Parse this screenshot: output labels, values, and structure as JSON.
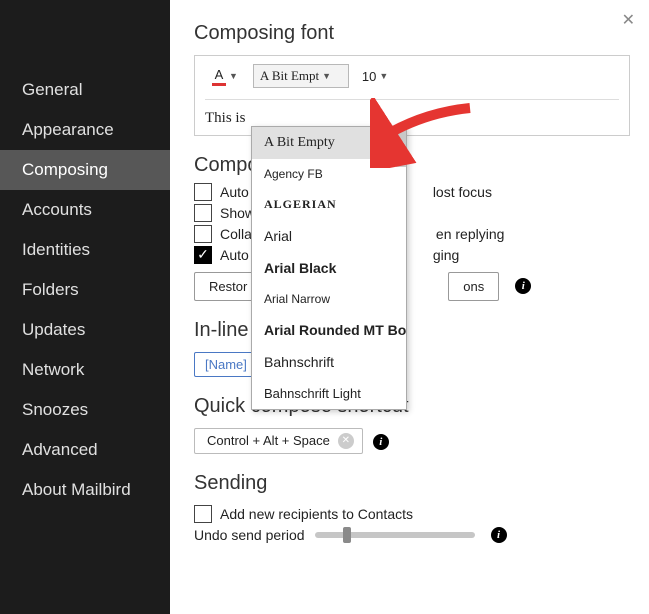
{
  "sidebar": {
    "items": [
      {
        "label": "General"
      },
      {
        "label": "Appearance"
      },
      {
        "label": "Composing",
        "active": true
      },
      {
        "label": "Accounts"
      },
      {
        "label": "Identities"
      },
      {
        "label": "Folders"
      },
      {
        "label": "Updates"
      },
      {
        "label": "Network"
      },
      {
        "label": "Snoozes"
      },
      {
        "label": "Advanced"
      },
      {
        "label": "About Mailbird"
      }
    ]
  },
  "close_symbol": "✕",
  "font_section": {
    "title": "Composing font",
    "color_letter": "A",
    "selected_font": "A Bit Empt",
    "selected_size": "10",
    "preview_text": "This is"
  },
  "font_dropdown": {
    "items": [
      {
        "label": "A Bit Empty",
        "family": "'Comic Sans MS', cursive",
        "weight": "400",
        "selected": true
      },
      {
        "label": "Agency FB",
        "family": "'Arial Narrow', Arial, sans-serif",
        "weight": "400",
        "size": "12px"
      },
      {
        "label": "ALGERIAN",
        "family": "'Times New Roman', serif",
        "weight": "700",
        "spacing": "1px",
        "size": "12px"
      },
      {
        "label": "Arial",
        "family": "Arial, sans-serif",
        "weight": "400"
      },
      {
        "label": "Arial Black",
        "family": "'Arial Black', Arial, sans-serif",
        "weight": "900"
      },
      {
        "label": "Arial Narrow",
        "family": "'Arial Narrow', Arial, sans-serif",
        "weight": "400",
        "size": "12px"
      },
      {
        "label": "Arial Rounded MT Bold",
        "family": "Arial, sans-serif",
        "weight": "700"
      },
      {
        "label": "Bahnschrift",
        "family": "Bahnschrift, Arial, sans-serif",
        "weight": "400"
      },
      {
        "label": "Bahnschrift Light",
        "family": "Bahnschrift, Arial, sans-serif",
        "weight": "300",
        "size": "13px"
      }
    ]
  },
  "composing": {
    "title": "Compo",
    "rows": [
      {
        "checked": false,
        "pre": "Auto",
        "post": "lost focus"
      },
      {
        "checked": false,
        "pre": "Show",
        "post": ""
      },
      {
        "checked": false,
        "pre": "Colla",
        "post": "en replying"
      },
      {
        "checked": true,
        "pre": "Auto",
        "post": "ging"
      }
    ],
    "btn_left": "Restor",
    "btn_right": "ons"
  },
  "inline": {
    "title": "In-line",
    "tag": "[Name]"
  },
  "shortcut": {
    "title": "Quick compose shortcut",
    "value": "Control + Alt + Space",
    "clear": "✕"
  },
  "sending": {
    "title": "Sending",
    "row_label": "Add new recipients to Contacts",
    "undo_label": "Undo send period"
  },
  "info_glyph": "i"
}
